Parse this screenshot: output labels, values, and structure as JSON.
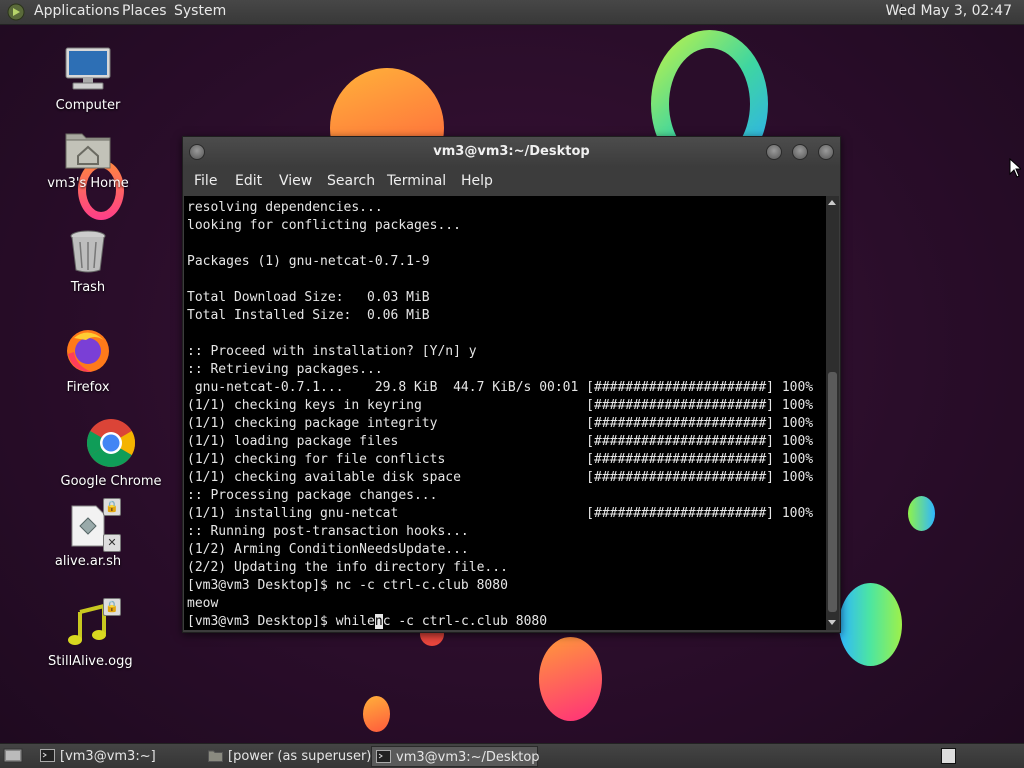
{
  "top_panel": {
    "menus": [
      "Applications",
      "Places",
      "System"
    ],
    "clock": "Wed May 3, 02:47"
  },
  "desktop_icons": [
    {
      "label": "Computer",
      "icon": "computer-icon"
    },
    {
      "label": "vm3's Home",
      "icon": "home-folder-icon"
    },
    {
      "label": "Trash",
      "icon": "trash-icon"
    },
    {
      "label": "Firefox",
      "icon": "firefox-icon"
    },
    {
      "label": "Google Chrome",
      "icon": "chrome-icon"
    },
    {
      "label": "alive.ar.sh",
      "icon": "script-file-icon"
    },
    {
      "label": "StillAlive.ogg",
      "icon": "audio-file-icon"
    }
  ],
  "terminal": {
    "title": "vm3@vm3:~/Desktop",
    "menu": [
      "File",
      "Edit",
      "View",
      "Search",
      "Terminal",
      "Help"
    ],
    "lines": [
      "resolving dependencies...",
      "looking for conflicting packages...",
      "",
      "Packages (1) gnu-netcat-0.7.1-9",
      "",
      "Total Download Size:   0.03 MiB",
      "Total Installed Size:  0.06 MiB",
      "",
      ":: Proceed with installation? [Y/n] y",
      ":: Retrieving packages...",
      " gnu-netcat-0.7.1...    29.8 KiB  44.7 KiB/s 00:01 [######################] 100%",
      "(1/1) checking keys in keyring                     [######################] 100%",
      "(1/1) checking package integrity                   [######################] 100%",
      "(1/1) loading package files                        [######################] 100%",
      "(1/1) checking for file conflicts                  [######################] 100%",
      "(1/1) checking available disk space                [######################] 100%",
      ":: Processing package changes...",
      "(1/1) installing gnu-netcat                        [######################] 100%",
      ":: Running post-transaction hooks...",
      "(1/2) Arming ConditionNeedsUpdate...",
      "(2/2) Updating the info directory file...",
      "[vm3@vm3 Desktop]$ nc -c ctrl-c.club 8080",
      "meow"
    ],
    "prompt": "[vm3@vm3 Desktop]$ ",
    "input_before_cursor": "while",
    "cursor_char": "n",
    "input_after_cursor": "c -c ctrl-c.club 8080"
  },
  "taskbar": {
    "tasks": [
      {
        "label": "[vm3@vm3:~]",
        "icon": "terminal-icon",
        "active": false
      },
      {
        "label": "[power (as superuser)]",
        "icon": "folder-icon",
        "active": false
      },
      {
        "label": "vm3@vm3:~/Desktop",
        "icon": "terminal-icon",
        "active": true
      }
    ]
  }
}
